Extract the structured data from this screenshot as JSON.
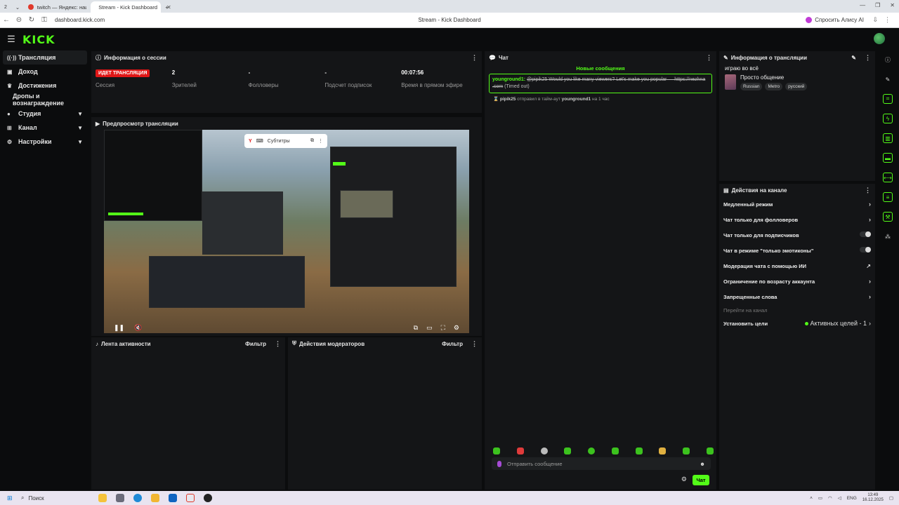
{
  "browser": {
    "tab_counter": "2",
    "tabs": [
      {
        "title": "twitch — Яндекс: нашлось",
        "favicon_color": "#e0392b",
        "active": false
      },
      {
        "title": "Stream - Kick Dashboard",
        "favicon_color": "#53fc18",
        "active": true
      }
    ],
    "url": "dashboard.kick.com",
    "page_title": "Stream - Kick Dashboard",
    "alice_button": "Спросить Алису AI"
  },
  "app": {
    "logo": "KICK",
    "accent": "#53fc18"
  },
  "sidebar": {
    "items": [
      {
        "label": "Трансляция",
        "icon": "broadcast-icon",
        "active": true,
        "chevron": false
      },
      {
        "label": "Доход",
        "icon": "wallet-icon",
        "active": false,
        "chevron": false
      },
      {
        "label": "Достижения",
        "icon": "trophy-icon",
        "active": false,
        "chevron": false
      },
      {
        "label": "Дропы и вознаграждение",
        "icon": "",
        "active": false,
        "chevron": false
      },
      {
        "label": "Студия",
        "icon": "studio-icon",
        "active": false,
        "chevron": true
      },
      {
        "label": "Канал",
        "icon": "channel-icon",
        "active": false,
        "chevron": true
      },
      {
        "label": "Настройки",
        "icon": "gear-icon",
        "active": false,
        "chevron": true
      }
    ]
  },
  "session": {
    "title": "Информация о сессии",
    "live_badge": "ИДЕТ ТРАНСЛЯЦИЯ",
    "session_label": "Сессия",
    "stats": [
      {
        "value": "2",
        "label": "Зрителей"
      },
      {
        "value": "-",
        "label": "Фолловеры"
      },
      {
        "value": "-",
        "label": "Подсчет подписок"
      },
      {
        "value": "00:07:56",
        "label": "Время в прямом эфире"
      }
    ]
  },
  "preview": {
    "title": "Предпросмотр трансляции",
    "subtitles_label": "Субтитры"
  },
  "activity": {
    "title": "Лента активности",
    "filter": "Фильтр"
  },
  "mod_actions": {
    "title": "Действия модераторов",
    "filter": "Фильтр"
  },
  "chat": {
    "title": "Чат",
    "new_messages": "Новые сообщения",
    "message_user": "younground1:",
    "message_text": "@pipik25 Would you like many viewers? Let's make you popular — https://nezhna .com",
    "message_status": "(Timed out)",
    "timeout_user": "pipik25",
    "timeout_mid": "отправил в тайм-аут",
    "timeout_target": "younground1",
    "timeout_when": "на 1 час",
    "input_placeholder": "Отправить сообщение",
    "send_button": "Чат"
  },
  "stream_info": {
    "title": "Информация о трансляции",
    "stream_title": "играю во всё",
    "category": "Просто общение",
    "tags": [
      "Russian",
      "Metro",
      "русский"
    ]
  },
  "channel_actions": {
    "title": "Действия на канале",
    "items": [
      {
        "label": "Медленный режим",
        "control": "chevron"
      },
      {
        "label": "Чат только для фолловеров",
        "control": "chevron"
      },
      {
        "label": "Чат только для подписчиков",
        "control": "toggle"
      },
      {
        "label": "Чат в режиме \"только эмотиконы\"",
        "control": "toggle"
      },
      {
        "label": "Модерация чата с помощью ИИ",
        "control": "external"
      },
      {
        "label": "Ограничение по возрасту аккаунта",
        "control": "chevron"
      },
      {
        "label": "Запрещенные слова",
        "control": "chevron"
      }
    ],
    "goto_channel": "Перейти на канал",
    "set_goals": "Установить цели",
    "active_goals": "Активных целей - 1"
  },
  "taskbar": {
    "search": "Поиск",
    "lang": "ENG",
    "time": "13:49",
    "date": "16.12.2025"
  }
}
